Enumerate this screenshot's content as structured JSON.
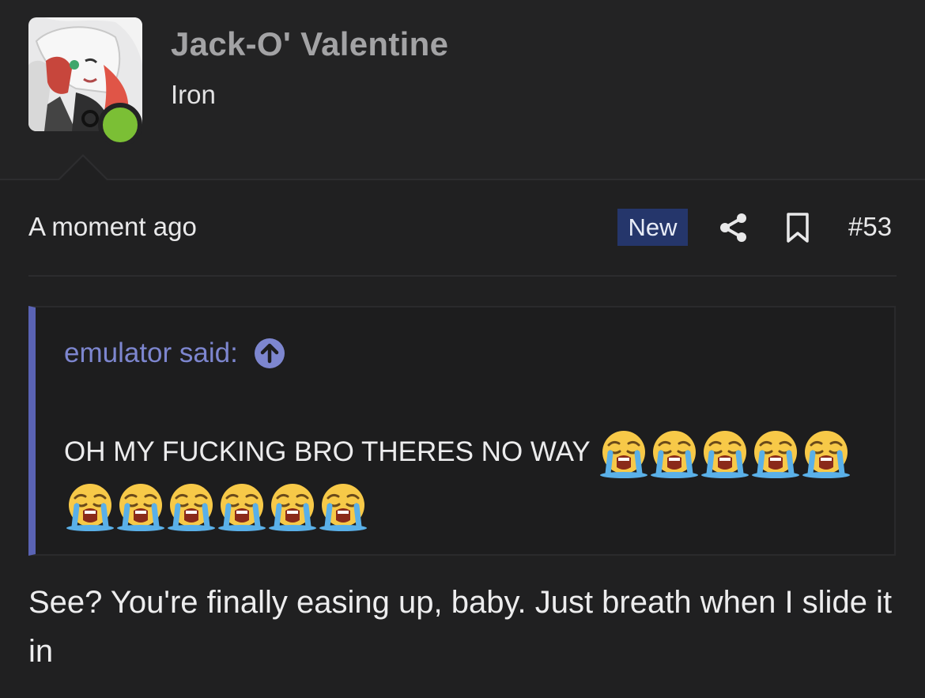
{
  "user": {
    "name": "Jack-O' Valentine",
    "title": "Iron",
    "online": true
  },
  "post": {
    "date": "A moment ago",
    "badge": "New",
    "number": "#53",
    "icons": [
      "share-icon",
      "bookmark-icon"
    ]
  },
  "quote": {
    "author_label": "emulator said:",
    "text": "OH MY FUCKING BRO THERES NO WAY",
    "emoji_count": 11,
    "emoji_name": "loudly-crying-face"
  },
  "reply": {
    "text": "See? You're finally easing up, baby. Just breath when I slide it in"
  },
  "colors": {
    "background": "#202021",
    "accent": "#5a63b4",
    "badge": "#25366b",
    "online": "#7bbf35"
  }
}
